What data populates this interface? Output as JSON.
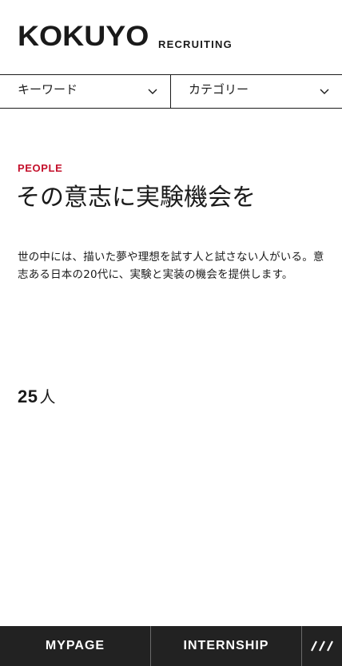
{
  "header": {
    "logo": "KOKUYO",
    "sub": "RECRUITING"
  },
  "filters": {
    "keyword_label": "キーワード",
    "category_label": "カテゴリー"
  },
  "main": {
    "eyebrow": "PEOPLE",
    "headline": "その意志に実験機会を",
    "lead": "世の中には、描いた夢や理想を試す人と試さない人がいる。意志ある日本の20代に、実験と実装の機会を提供します。",
    "count_number": "25",
    "count_unit": "人"
  },
  "bottom_nav": {
    "mypage": "MYPAGE",
    "internship": "INTERNSHIP"
  },
  "colors": {
    "accent": "#c4102b",
    "text": "#1a1a1a",
    "bar": "#222222"
  }
}
